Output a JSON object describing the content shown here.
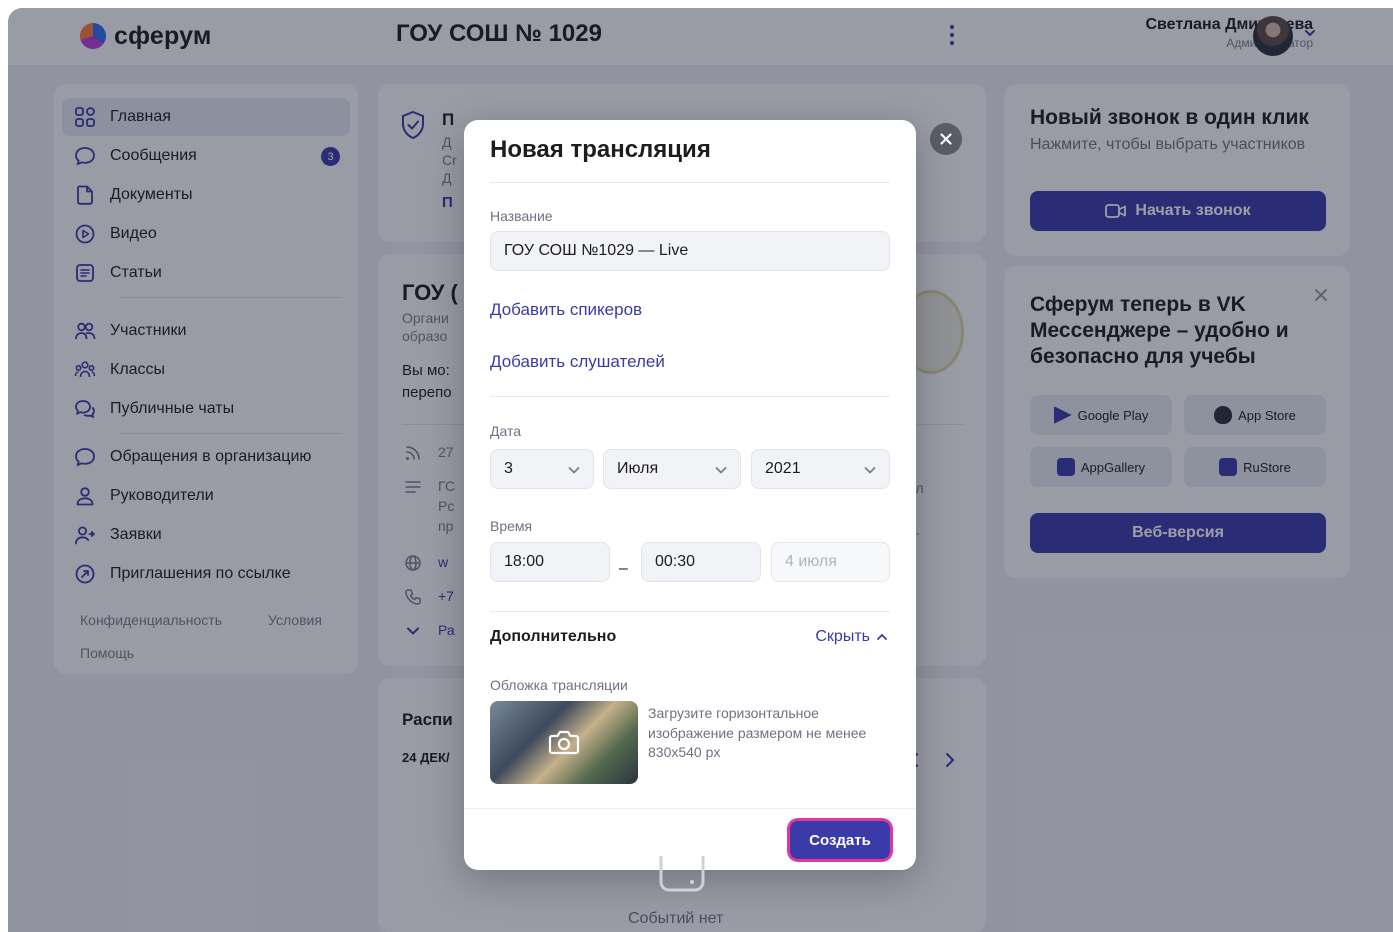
{
  "header": {
    "logo_text": "сферум",
    "org_title": "ГОУ СОШ № 1029",
    "user_name": "Светлана Дмитриева",
    "user_role": "Администратор"
  },
  "sidebar": {
    "items": [
      {
        "label": "Главная",
        "icon": "grid-icon",
        "active": true
      },
      {
        "label": "Сообщения",
        "icon": "chat-icon",
        "badge": "3"
      },
      {
        "label": "Документы",
        "icon": "document-icon"
      },
      {
        "label": "Видео",
        "icon": "play-icon"
      },
      {
        "label": "Статьи",
        "icon": "article-icon"
      },
      {
        "label": "Участники",
        "icon": "users-icon"
      },
      {
        "label": "Классы",
        "icon": "group-icon"
      },
      {
        "label": "Публичные чаты",
        "icon": "public-chat-icon"
      },
      {
        "label": "Обращения в организацию",
        "icon": "chat-icon"
      },
      {
        "label": "Руководители",
        "icon": "person-icon"
      },
      {
        "label": "Заявки",
        "icon": "person-add-icon"
      },
      {
        "label": "Приглашения по ссылке",
        "icon": "link-icon"
      }
    ],
    "footer": {
      "privacy": "Конфиденциальность",
      "terms": "Условия",
      "help": "Помощь"
    }
  },
  "background_cards": {
    "notice_title_fragment": "П",
    "notice_lines": [
      "Д",
      "Cr",
      "Д"
    ],
    "notice_link": "П",
    "org_heading_fragment": "ГОУ (",
    "org_sub_1": "Органи",
    "org_sub_2": "образо",
    "org_text_1": "Вы мо:",
    "org_text_2": "перепо",
    "info_rss": "27",
    "info_desc_1": "ГС",
    "info_desc_2": "Рс",
    "info_desc_3": "пр",
    "info_web": "w",
    "info_phone": "+7",
    "info_more": "Ра",
    "right_frag_1": "ол",
    "right_frag_2": "|",
    "right_frag_3": "...",
    "schedule_title_fragment": "Распи",
    "schedule_date_fragment": "24 ДЕК/",
    "no_events": "Событий нет"
  },
  "right_panel": {
    "call_card": {
      "title": "Новый звонок в один клик",
      "subtitle": "Нажмите, чтобы выбрать участников",
      "button": "Начать звонок"
    },
    "promo_card": {
      "title": "Сферум теперь в VK Мессенджере – удобно и безопасно для учебы",
      "stores": [
        "Google Play",
        "App Store",
        "AppGallery",
        "RuStore"
      ],
      "web_button": "Веб-версия"
    }
  },
  "modal": {
    "title": "Новая трансляция",
    "name_label": "Название",
    "name_value": "ГОУ СОШ №1029 — Live",
    "add_speakers": "Добавить спикеров",
    "add_listeners": "Добавить слушателей",
    "date_label": "Дата",
    "date_day": "3",
    "date_month": "Июля",
    "date_year": "2021",
    "time_label": "Время",
    "time_start": "18:00",
    "time_dash": "–",
    "time_end": "00:30",
    "time_end_date": "4 июля",
    "extra_section": "Дополнительно",
    "hide_link": "Скрыть",
    "cover_label": "Обложка трансляции",
    "cover_hint": "Загрузите горизонтальное изображение размером не менее 830x540 px",
    "create_button": "Создать"
  },
  "colors": {
    "accent": "#3a3aa8",
    "focus_ring": "#e0399c",
    "overlay": "#161a30"
  }
}
